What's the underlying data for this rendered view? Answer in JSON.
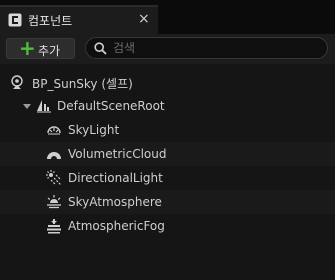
{
  "panel": {
    "title": "컴포넌트",
    "close_glyph": "×"
  },
  "toolbar": {
    "add_label": "추가",
    "search_placeholder": "검색"
  },
  "tree": {
    "root": {
      "label": "BP_SunSky (셀프)",
      "icon": "actor-icon"
    },
    "scene_root": {
      "label": "DefaultSceneRoot",
      "icon": "scene-root-icon",
      "expanded": true
    },
    "children": [
      {
        "label": "SkyLight",
        "icon": "skylight-icon"
      },
      {
        "label": "VolumetricCloud",
        "icon": "cloud-icon"
      },
      {
        "label": "DirectionalLight",
        "icon": "sun-icon"
      },
      {
        "label": "SkyAtmosphere",
        "icon": "atmosphere-icon"
      },
      {
        "label": "AtmosphericFog",
        "icon": "fog-icon"
      }
    ]
  },
  "colors": {
    "accent_add": "#4fbe3c",
    "background": "#151515"
  }
}
